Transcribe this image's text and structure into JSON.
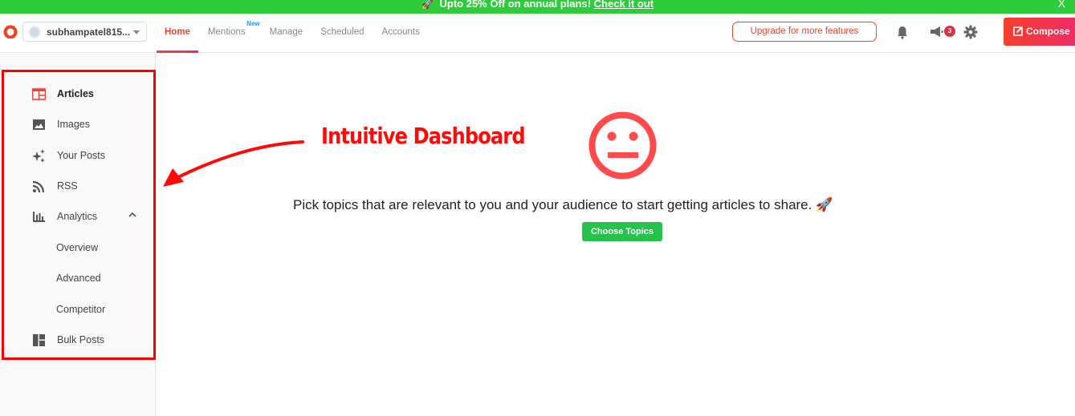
{
  "promo": {
    "icon": "🚀",
    "text": "Upto 25% Off on annual plans!",
    "link": "Check it out",
    "close": "X"
  },
  "header": {
    "account_name": "subhampatel815...",
    "tabs": [
      {
        "label": "Home",
        "active": true
      },
      {
        "label": "Mentions",
        "badge": "New"
      },
      {
        "label": "Manage"
      },
      {
        "label": "Scheduled"
      },
      {
        "label": "Accounts"
      }
    ],
    "upgrade_label": "Upgrade for more features",
    "announcements_count": "3",
    "compose_label": "Compose",
    "accent": "#e8442f"
  },
  "sidebar": {
    "items": [
      {
        "label": "Articles",
        "icon": "articles-icon",
        "active": true
      },
      {
        "label": "Images",
        "icon": "image-icon"
      },
      {
        "label": "Your Posts",
        "icon": "sparkle-icon"
      },
      {
        "label": "RSS",
        "icon": "rss-icon"
      },
      {
        "label": "Analytics",
        "icon": "bar-chart-icon",
        "expanded": true
      },
      {
        "label": "Overview",
        "sub": true
      },
      {
        "label": "Advanced",
        "sub": true
      },
      {
        "label": "Competitor",
        "sub": true
      },
      {
        "label": "Bulk Posts",
        "icon": "layout-icon"
      }
    ]
  },
  "main": {
    "annotation": "Intuitive Dashboard",
    "message": "Pick topics that are relevant to you and your audience to start getting articles to share.",
    "message_icon": "🚀",
    "choose_label": "Choose Topics"
  }
}
